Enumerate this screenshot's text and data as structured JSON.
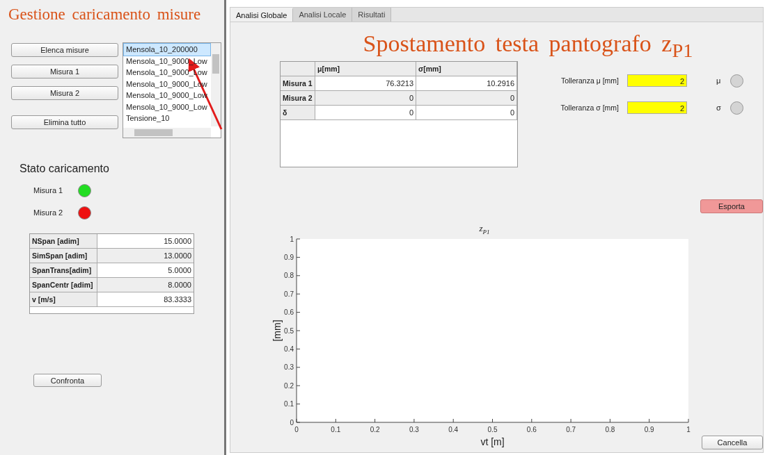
{
  "left_panel": {
    "title": "Gestione caricamento misure",
    "buttons": [
      "Elenca misure",
      "Misura 1",
      "Misura 2",
      "Elimina tutto"
    ],
    "list": {
      "items": [
        {
          "label": "Mensola_10_200000",
          "selected": true
        },
        {
          "label": "Mensola_10_9000_Low",
          "selected": false
        },
        {
          "label": "Mensola_10_9000_Low",
          "selected": false
        },
        {
          "label": "Mensola_10_9000_Low",
          "selected": false
        },
        {
          "label": "Mensola_10_9000_Low",
          "selected": false
        },
        {
          "label": "Mensola_10_9000_Low",
          "selected": false
        },
        {
          "label": "Tensione_10",
          "selected": false
        }
      ]
    },
    "status": {
      "title": "Stato caricamento",
      "lamps": [
        {
          "label": "Misura 1",
          "color": "#22dd22"
        },
        {
          "label": "Misura 2",
          "color": "#ee1111"
        }
      ]
    },
    "params": [
      {
        "label": "NSpan [adim]",
        "value": "15.0000"
      },
      {
        "label": "SimSpan [adim]",
        "value": "13.0000"
      },
      {
        "label": "SpanTrans[adim]",
        "value": "5.0000"
      },
      {
        "label": "SpanCentr [adim]",
        "value": "8.0000"
      },
      {
        "label": "v [m/s]",
        "value": "83.3333"
      }
    ],
    "compare_button": "Confronta"
  },
  "tabs": [
    {
      "label": "Analisi Globale",
      "selected": true
    },
    {
      "label": "Analisi Locale",
      "selected": false
    },
    {
      "label": "Risultati",
      "selected": false
    }
  ],
  "global": {
    "title": "Spostamento testa pantografo z$_{P1}$",
    "stats_table": {
      "columns": [
        "μ[mm]",
        "σ[mm]"
      ],
      "rows": [
        {
          "label": "Misura 1",
          "values": [
            "76.3213",
            "10.2916"
          ]
        },
        {
          "label": "Misura 2",
          "values": [
            "0",
            "0"
          ]
        },
        {
          "label": "δ",
          "values": [
            "0",
            "0"
          ]
        }
      ]
    },
    "tolerances": [
      {
        "label": "Tolleranza μ [mm]",
        "value": "2",
        "symbol": "μ",
        "lit": false
      },
      {
        "label": "Tolleranza σ [mm]",
        "value": "2",
        "symbol": "σ",
        "lit": false
      }
    ],
    "export_button": "Esporta",
    "chart_data": {
      "type": "line",
      "title": "z$_{P1}$",
      "xlabel": "vt [m]",
      "ylabel": "[mm]",
      "xlim": [
        0,
        1
      ],
      "ylim": [
        0,
        1
      ],
      "xticks": [
        0,
        0.1,
        0.2,
        0.3,
        0.4,
        0.5,
        0.6,
        0.7,
        0.8,
        0.9,
        1
      ],
      "yticks": [
        0,
        0.1,
        0.2,
        0.3,
        0.4,
        0.5,
        0.6,
        0.7,
        0.8,
        0.9,
        1
      ]
    },
    "cancel_button": "Cancella"
  }
}
